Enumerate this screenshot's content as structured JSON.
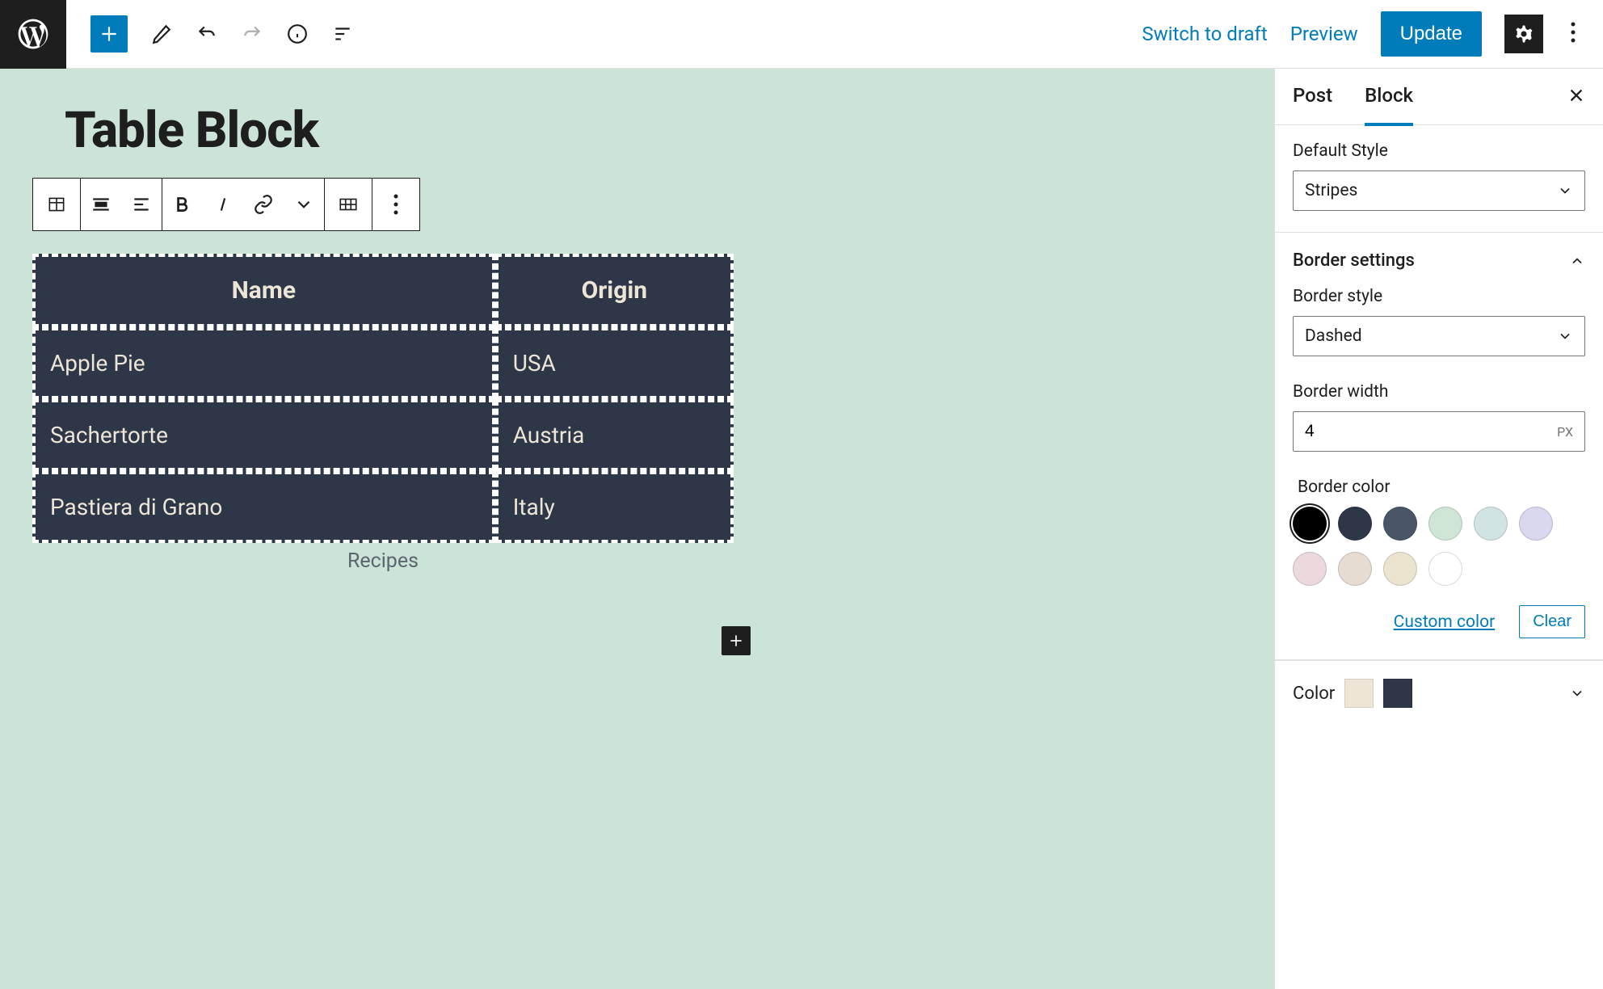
{
  "header": {
    "switch_to_draft": "Switch to draft",
    "preview": "Preview",
    "update": "Update"
  },
  "editor": {
    "post_title": "Table Block",
    "caption": "Recipes",
    "table": {
      "headers": [
        "Name",
        "Origin"
      ],
      "rows": [
        [
          "Apple Pie",
          "USA"
        ],
        [
          "Sachertorte",
          "Austria"
        ],
        [
          "Pastiera di Grano",
          "Italy"
        ]
      ]
    }
  },
  "sidebar": {
    "tabs": {
      "post": "Post",
      "block": "Block"
    },
    "default_style_label": "Default Style",
    "default_style_value": "Stripes",
    "panel_border_settings": "Border settings",
    "border_style_label": "Border style",
    "border_style_value": "Dashed",
    "border_width_label": "Border width",
    "border_width_value": "4",
    "border_width_unit": "PX",
    "border_color_label": "Border color",
    "custom_color": "Custom color",
    "clear": "Clear",
    "color_label": "Color",
    "swatches": [
      "#000000",
      "#2d3748",
      "#4a5568",
      "#cfe6d7",
      "#d2e3e3",
      "#d9d8ee",
      "#ecd9dd",
      "#e6dcd1",
      "#ebe4ce",
      "#ffffff"
    ],
    "selected_swatch": "#000000",
    "color_mini": [
      "#ede5d6",
      "#2d3748"
    ]
  }
}
